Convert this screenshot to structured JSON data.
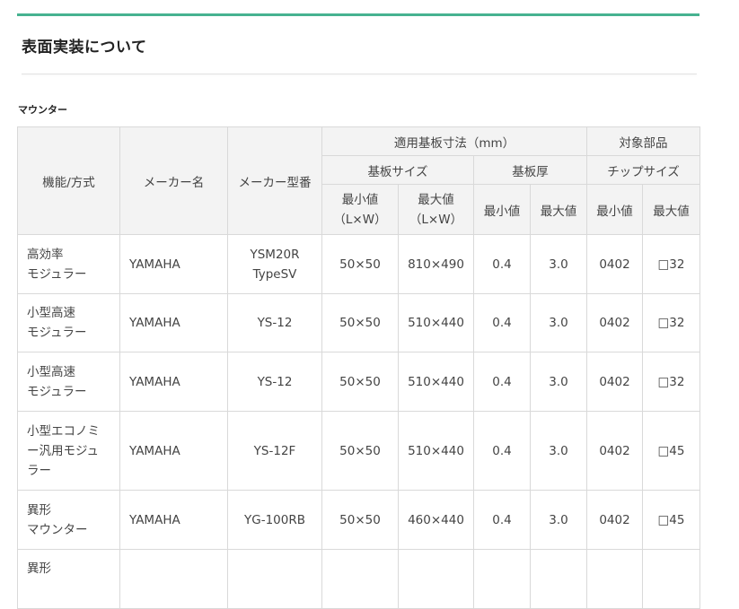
{
  "heading": "表面実装について",
  "subheading": "マウンター",
  "table": {
    "headers": {
      "function": "機能/方式",
      "maker": "メーカー名",
      "model": "メーカー型番",
      "board_size": "適用基板寸法（mm）",
      "target": "対象部品",
      "board_dims": "基板サイズ",
      "thickness": "基板厚",
      "chip_size": "チップサイズ",
      "min_lw_1": "最小値",
      "min_lw_2": "（L×W）",
      "max_lw_1": "最大値",
      "max_lw_2": "（L×W）",
      "min": "最小値",
      "max": "最大値",
      "chip_min": "最小値",
      "chip_max": "最大値"
    },
    "rows": [
      {
        "fn1": "高効率",
        "fn2": "モジュラー",
        "fn3": "",
        "maker": "YAMAHA",
        "model1": "YSM20R",
        "model2": "TypeSV",
        "min_size": "50×50",
        "max_size": "810×490",
        "t_min": "0.4",
        "t_max": "3.0",
        "c_min": "0402",
        "c_max": "□32"
      },
      {
        "fn1": "小型高速",
        "fn2": "モジュラー",
        "fn3": "",
        "maker": "YAMAHA",
        "model1": "YS-12",
        "model2": "",
        "min_size": "50×50",
        "max_size": "510×440",
        "t_min": "0.4",
        "t_max": "3.0",
        "c_min": "0402",
        "c_max": "□32"
      },
      {
        "fn1": "小型高速",
        "fn2": "モジュラー",
        "fn3": "",
        "maker": "YAMAHA",
        "model1": "YS-12",
        "model2": "",
        "min_size": "50×50",
        "max_size": "510×440",
        "t_min": "0.4",
        "t_max": "3.0",
        "c_min": "0402",
        "c_max": "□32"
      },
      {
        "fn1": "小型エコノミ",
        "fn2": "ー汎用モジュ",
        "fn3": "ラー",
        "maker": "YAMAHA",
        "model1": "YS-12F",
        "model2": "",
        "min_size": "50×50",
        "max_size": "510×440",
        "t_min": "0.4",
        "t_max": "3.0",
        "c_min": "0402",
        "c_max": "□45"
      },
      {
        "fn1": "異形",
        "fn2": "マウンター",
        "fn3": "",
        "maker": "YAMAHA",
        "model1": "YG-100RB",
        "model2": "",
        "min_size": "50×50",
        "max_size": "460×440",
        "t_min": "0.4",
        "t_max": "3.0",
        "c_min": "0402",
        "c_max": "□45"
      },
      {
        "fn1": "異形",
        "fn2": "",
        "fn3": "",
        "maker": "",
        "model1": "",
        "model2": "",
        "min_size": "",
        "max_size": "",
        "t_min": "",
        "t_max": "",
        "c_min": "",
        "c_max": ""
      }
    ]
  },
  "colors": {
    "accent": "#46b290",
    "header_bg": "#f3f3f3",
    "border": "#d9d9d9"
  }
}
